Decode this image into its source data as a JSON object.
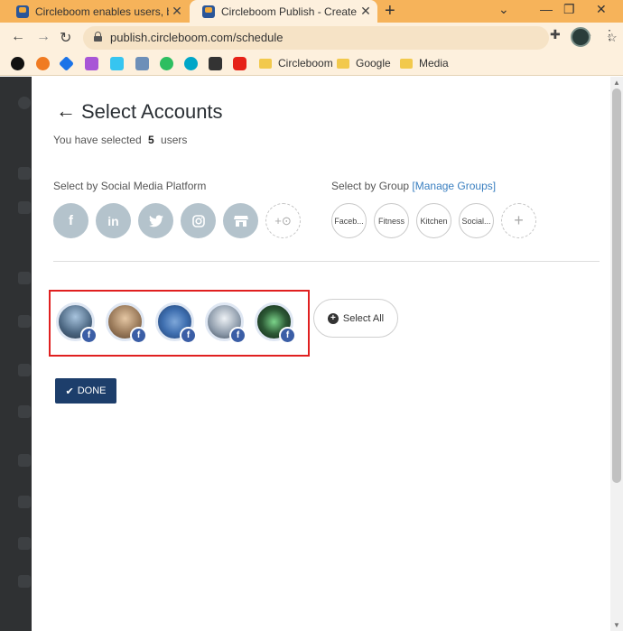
{
  "browser": {
    "tabs": [
      {
        "label": "Circleboom enables users, brand",
        "active": false
      },
      {
        "label": "Circleboom Publish - Create New",
        "active": true
      }
    ],
    "new_tab_icon": "plus-icon",
    "url": "publish.circleboom.com/schedule",
    "bookmarks": [
      {
        "type": "folder",
        "label": "Circleboom"
      },
      {
        "type": "folder",
        "label": "Google"
      },
      {
        "type": "folder",
        "label": "Media"
      }
    ]
  },
  "modal": {
    "title": "Select Accounts",
    "selected_prefix": "You have selected",
    "selected_count": "5",
    "selected_suffix": "users",
    "platform_label": "Select by Social Media Platform",
    "platforms": [
      "f",
      "in",
      "t",
      "ig",
      "store"
    ],
    "group_label": "Select by Group",
    "manage_groups": "[Manage Groups]",
    "groups": [
      "Faceb...",
      "Fitness",
      "Kitchen",
      "Social..."
    ],
    "accounts": [
      {
        "network": "f",
        "color": "#4a6580"
      },
      {
        "network": "f",
        "color": "#9b7b5b"
      },
      {
        "network": "f",
        "color": "#3f6fb0"
      },
      {
        "network": "f",
        "color": "#8a98a8"
      },
      {
        "network": "f",
        "color": "#2d5a36"
      }
    ],
    "select_all": "Select All",
    "done": "DONE",
    "colors": {
      "platform_circle": "#b4c3cc",
      "done_button": "#1d3e6b",
      "facebook_badge": "#3b5ea6",
      "highlight_border": "#e02020",
      "tab_bar": "#f6b35a"
    }
  }
}
